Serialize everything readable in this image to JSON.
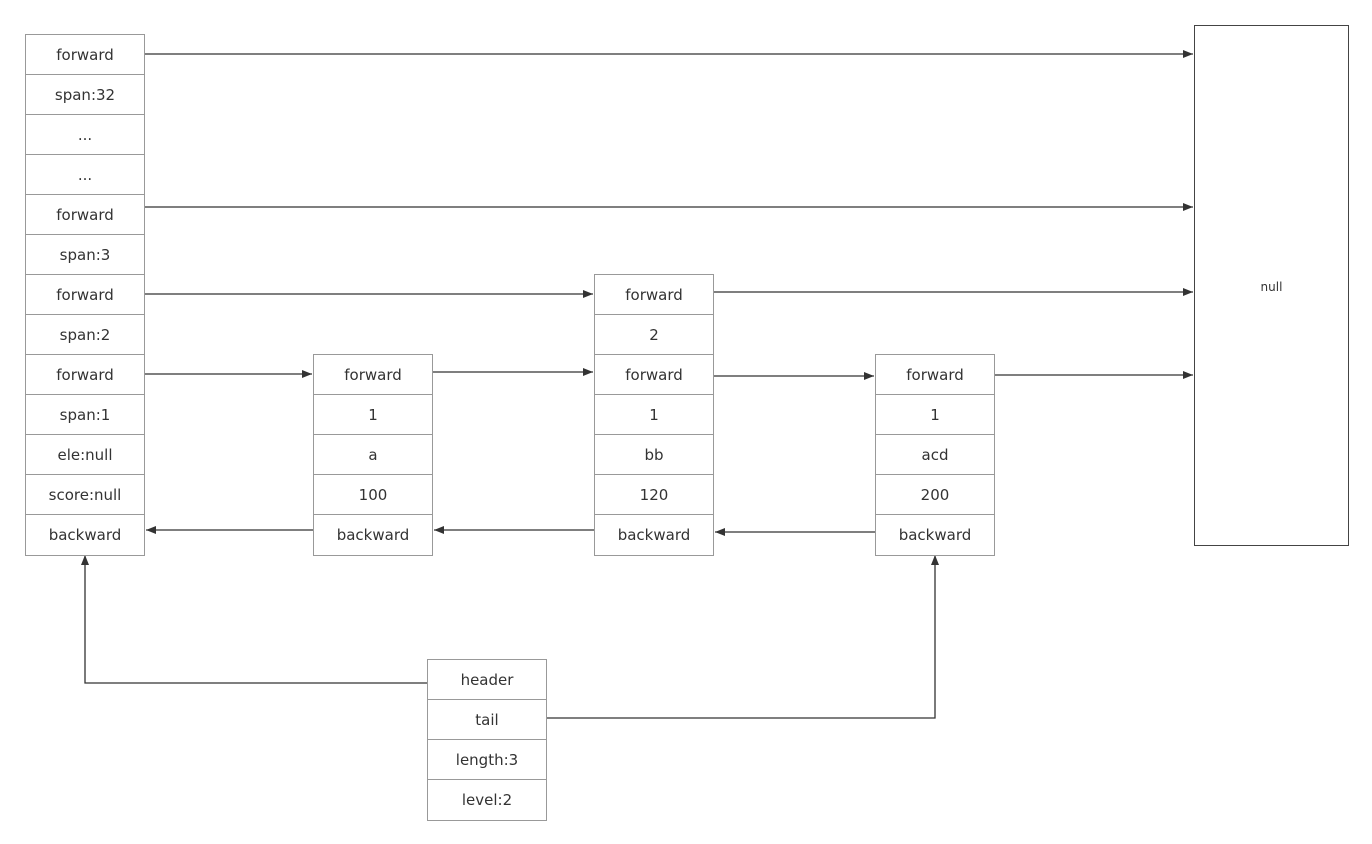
{
  "header_node": [
    "forward",
    "span:32",
    "...",
    "...",
    "forward",
    "span:3",
    "forward",
    "span:2",
    "forward",
    "span:1",
    "ele:null",
    "score:null",
    "backward"
  ],
  "nodes": [
    [
      "forward",
      "1",
      "a",
      "100",
      "backward"
    ],
    [
      "forward",
      "2",
      "forward",
      "1",
      "bb",
      "120",
      "backward"
    ],
    [
      "forward",
      "1",
      "acd",
      "200",
      "backward"
    ]
  ],
  "list_struct": [
    "header",
    "tail",
    "length:3",
    "level:2"
  ],
  "null_label": "null",
  "colors": {
    "border": "#999999",
    "arrow": "#333333",
    "text": "#333333"
  }
}
